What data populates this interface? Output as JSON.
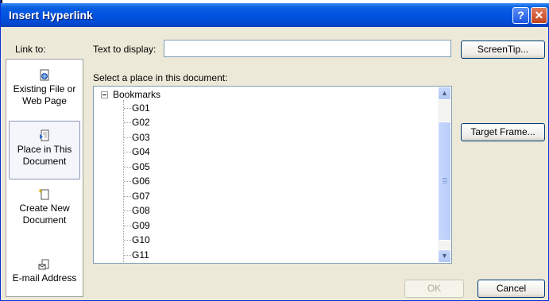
{
  "window": {
    "title": "Insert Hyperlink",
    "help_icon": "?",
    "close_icon": "✕"
  },
  "link_to": {
    "label": "Link to:",
    "items": [
      {
        "label_line1": "Existing File or",
        "label_line2": "Web Page",
        "icon": "globe-document-icon"
      },
      {
        "label_line1": "Place in This",
        "label_line2": "Document",
        "icon": "document-place-icon",
        "selected": true
      },
      {
        "label_line1": "Create New",
        "label_line2": "Document",
        "icon": "new-document-icon"
      },
      {
        "label_line1": "E-mail Address",
        "label_line2": "",
        "icon": "email-icon"
      }
    ]
  },
  "text_to_display": {
    "label": "Text to display:",
    "value": ""
  },
  "place_list": {
    "label": "Select a place in this document:",
    "root": "Bookmarks",
    "items": [
      "G01",
      "G02",
      "G03",
      "G04",
      "G05",
      "G06",
      "G07",
      "G08",
      "G09",
      "G10",
      "G11"
    ]
  },
  "buttons": {
    "screentip": "ScreenTip...",
    "target_frame": "Target Frame...",
    "ok": "OK",
    "cancel": "Cancel"
  },
  "scrollbar": {
    "up": "▲",
    "down": "▼"
  }
}
